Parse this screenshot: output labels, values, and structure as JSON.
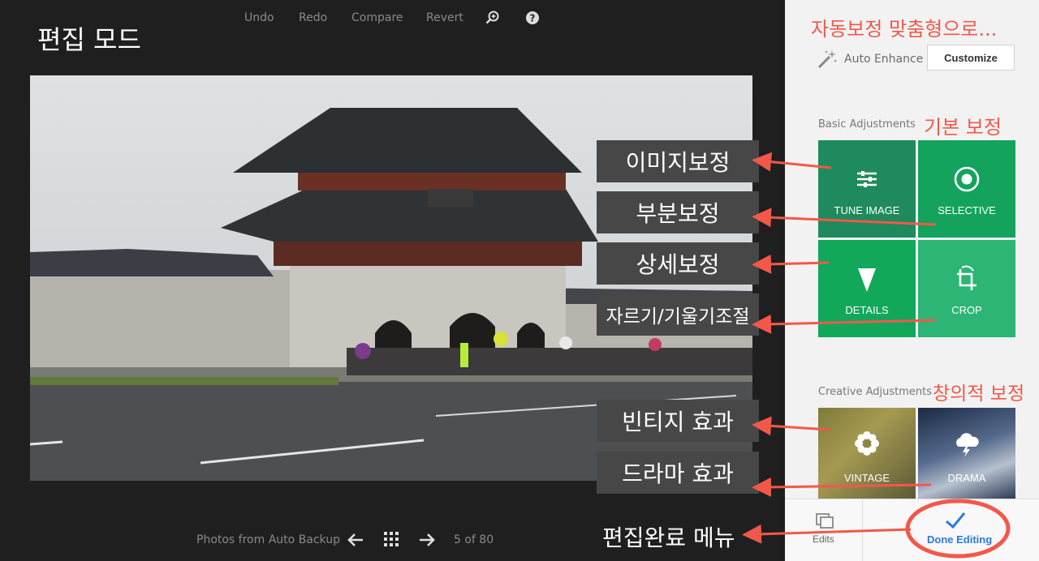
{
  "overlay_title": "편집 모드",
  "toolbar": {
    "undo": "Undo",
    "redo": "Redo",
    "compare": "Compare",
    "revert": "Revert",
    "zoom_icon": "zoom-icon",
    "help_icon": "help-icon"
  },
  "bottom_bar": {
    "source": "Photos from Auto Backup",
    "counter": "5 of 80"
  },
  "right_panel": {
    "auto_callout": "자동보정 맞춤형으로...",
    "auto_enhance": "Auto Enhance",
    "customize": "Customize",
    "basic_label": "Basic Adjustments",
    "basic_callout": "기본 보정",
    "creative_label": "Creative Adjustments",
    "creative_callout": "창의적 보정",
    "tiles": [
      {
        "label": "TUNE IMAGE",
        "color": "#1f8a5d"
      },
      {
        "label": "SELECTIVE",
        "color": "#13a35d"
      },
      {
        "label": "DETAILS",
        "color": "#11a85a"
      },
      {
        "label": "CROP",
        "color": "#2cb574"
      }
    ],
    "creative_tiles": [
      {
        "label": "VINTAGE"
      },
      {
        "label": "DRAMA"
      }
    ],
    "footer": {
      "edits": "Edits",
      "done": "Done Editing"
    }
  },
  "callouts": {
    "tune": "이미지보정",
    "selective": "부분보정",
    "details": "상세보정",
    "crop": "자르기/기울기조절",
    "vintage": "빈티지 효과",
    "drama": "드라마 효과",
    "done": "편집완료 메뉴"
  },
  "colors": {
    "accent_red": "#f2584a",
    "done_blue": "#2a7ae2"
  }
}
